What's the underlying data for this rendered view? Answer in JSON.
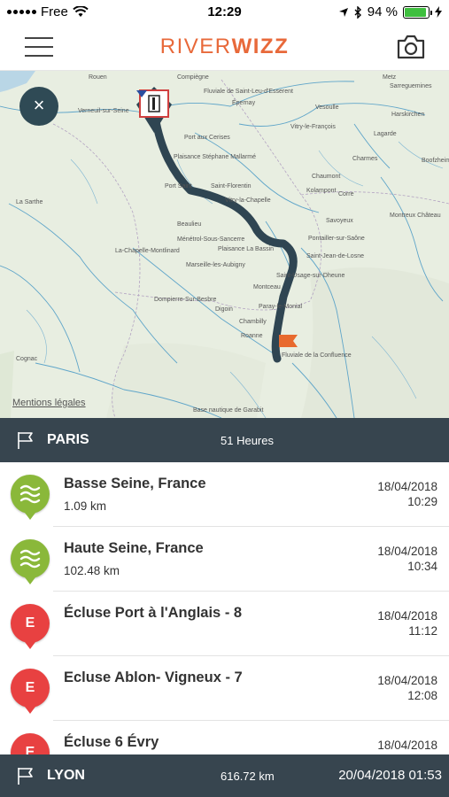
{
  "status_bar": {
    "carrier": "Free",
    "time": "12:29",
    "battery": "94 %",
    "battery_level": 0.94
  },
  "app": {
    "logo_part1": "RIVER",
    "logo_part2": "WIZZ",
    "brand_color": "#e8693a"
  },
  "map": {
    "close_label": "×",
    "legal_link": "Mentions légales",
    "labels": [
      "Rouen",
      "Compiègne",
      "Verneuil-sur-Seine",
      "Fluviale de Saint-Leu-d'Esserent",
      "Épernay",
      "Port aux Cerises",
      "Plaisance Stéphane Mallarmé",
      "Port Saint",
      "Saint-Florentin",
      "Vitry-la-Chapelle",
      "Beaulieu",
      "Ménétrol-Sous-Sancerre",
      "Plaisance La Bassin",
      "La-Chapelle-Montlinard",
      "Marseille-les-Aubigny",
      "Dompierre-Sur-Besbre",
      "Digoin",
      "Chambilly",
      "Paray-le-Monial",
      "Roanne",
      "Fluviale de la Confluence",
      "Cognac",
      "Base nautique de Garabit",
      "Saint-Jean-de-Losne",
      "Pontailler-sur-Saône",
      "Savoyeux",
      "Corre",
      "Charmes",
      "Kolampont",
      "Chaumont",
      "Vitry-le-François",
      "Vesoulle",
      "Lagarde",
      "Sarreguemines",
      "Harskirchen",
      "Boofzheim",
      "Montreux Château",
      "Metz",
      "La Sarthe",
      "Saint-Usage-sur-Dheune",
      "Montceau"
    ]
  },
  "route": {
    "start_name": "PARIS",
    "start_duration": "51 Heures",
    "end_name": "LYON",
    "end_distance": "616.72 km",
    "end_datetime": "20/04/2018 01:53"
  },
  "items": [
    {
      "type": "river",
      "icon": "waves-icon",
      "title": "Basse Seine, France",
      "distance": "1.09 km",
      "date": "18/04/2018",
      "time": "10:29"
    },
    {
      "type": "river",
      "icon": "waves-icon",
      "title": "Haute Seine, France",
      "distance": "102.48 km",
      "date": "18/04/2018",
      "time": "10:34"
    },
    {
      "type": "lock",
      "icon": "E",
      "title": "Écluse Port à l'Anglais - 8",
      "distance": "",
      "date": "18/04/2018",
      "time": "11:12"
    },
    {
      "type": "lock",
      "icon": "E",
      "title": "Ecluse Ablon- Vigneux - 7",
      "distance": "",
      "date": "18/04/2018",
      "time": "12:08"
    },
    {
      "type": "lock",
      "icon": "E",
      "title": "Écluse 6 Évry",
      "distance": "",
      "date": "18/04/2018",
      "time": ""
    }
  ],
  "colors": {
    "route_line": "#2f4552",
    "river_badge": "#8ab83a",
    "lock_badge": "#e84141",
    "header_bar": "#37454f"
  }
}
